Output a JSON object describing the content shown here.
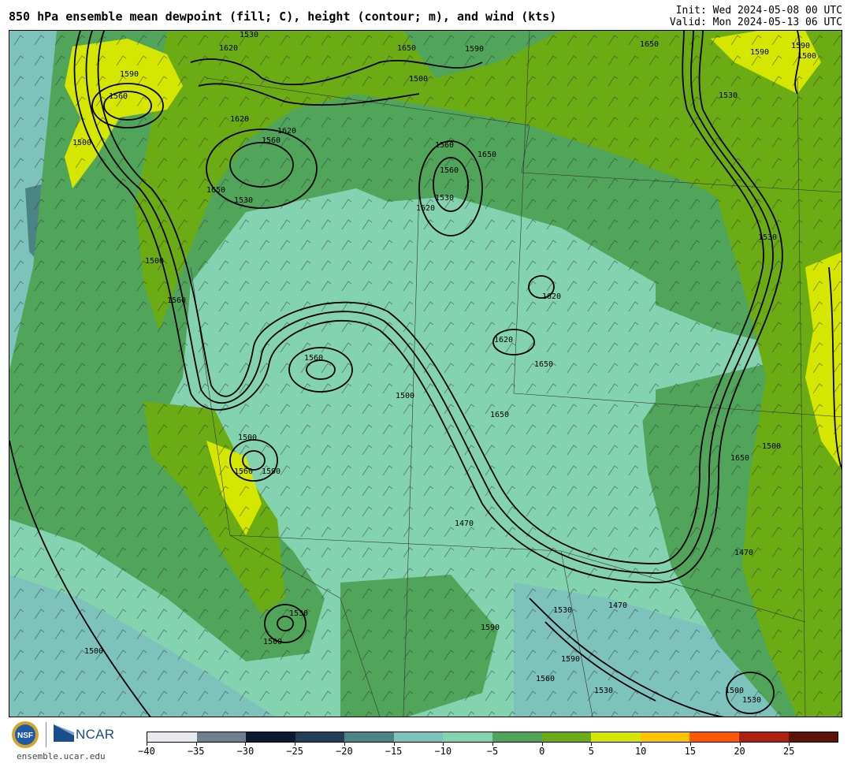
{
  "header": {
    "title": "850 hPa ensemble mean dewpoint (fill; C), height (contour; m), and wind (kts)",
    "init": "Init: Wed 2024-05-08 00 UTC",
    "valid": "Valid: Mon 2024-05-13 06 UTC"
  },
  "colorbar": {
    "colors": [
      "#e8eaf0",
      "#6e7f8f",
      "#0e1a32",
      "#233e57",
      "#4a8485",
      "#7ec3bb",
      "#83d3b1",
      "#51a55a",
      "#6bac14",
      "#d5e700",
      "#fdc500",
      "#fd5800",
      "#b02010",
      "#5e1208"
    ],
    "tick_labels": [
      "−40",
      "−35",
      "−30",
      "−25",
      "−20",
      "−15",
      "−10",
      "−5",
      "0",
      "5",
      "10",
      "15",
      "20",
      "25"
    ]
  },
  "contour_labels": [
    "1590",
    "1560",
    "1620",
    "1530",
    "1650",
    "1500",
    "1590",
    "1560",
    "1500",
    "1620",
    "1650",
    "1560",
    "1530",
    "1530",
    "1500",
    "1560",
    "1590",
    "1500",
    "1530",
    "1560",
    "1500",
    "1590",
    "1530",
    "1650",
    "1500",
    "1620",
    "1500",
    "1530",
    "1470",
    "1560",
    "1590",
    "1500",
    "1530",
    "1470",
    "1530",
    "1560",
    "1620",
    "1650",
    "1590",
    "1530",
    "1590",
    "1500",
    "1650",
    "1560",
    "1620",
    "1650",
    "1650",
    "1620",
    "1500",
    "1470"
  ],
  "logos": {
    "nsf": "NSF",
    "ncar": "NCAR",
    "site": "ensemble.ucar.edu"
  }
}
